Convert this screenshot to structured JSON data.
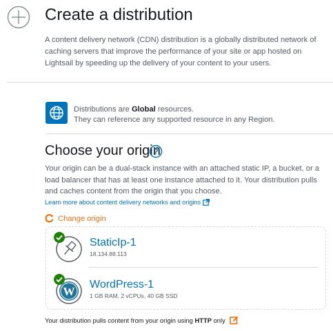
{
  "header": {
    "icon": "plus-circle-icon",
    "title": "Create a distribution",
    "description": "A content delivery network (CDN) distribution is a globally distributed network of caching servers that improve the performance of your site or app hosted on Lightsail by speeding up the delivery of your content to your users."
  },
  "global_notice": {
    "icon": "globe-icon",
    "line1_prefix": "Distributions are ",
    "line1_bold": "Global",
    "line1_suffix": " resources.",
    "line2": "They can reference any supported resource in any Region."
  },
  "origin": {
    "title": "Choose your origin",
    "help_icon": "help-icon",
    "description": "Your origin can be a dual-stack instance with an attached static IP, a bucket, or a load balancer that has at least one instance attached to it. Your distribution pulls and caches content from the origin that you choose.",
    "learn_more_label": "Learn more about content delivery networks and origins",
    "change_origin_label": "Change origin",
    "resources": [
      {
        "name": "StaticIp-1",
        "detail": "18.134.88.113",
        "icon": "pin-icon",
        "status": "check-icon"
      },
      {
        "name": "WordPress-1",
        "detail": "1 GB RAM, 2 vCPUs, 40 GB SSD",
        "icon": "wordpress-icon",
        "status": "check-icon"
      }
    ]
  },
  "footer": {
    "prefix": "Your distribution pulls content from your origin using ",
    "protocol": "HTTP",
    "suffix": " only",
    "edit_icon": "edit-icon"
  },
  "colors": {
    "link": "#0073bb",
    "accent_orange": "#ec7211",
    "success_green": "#1d8102"
  }
}
